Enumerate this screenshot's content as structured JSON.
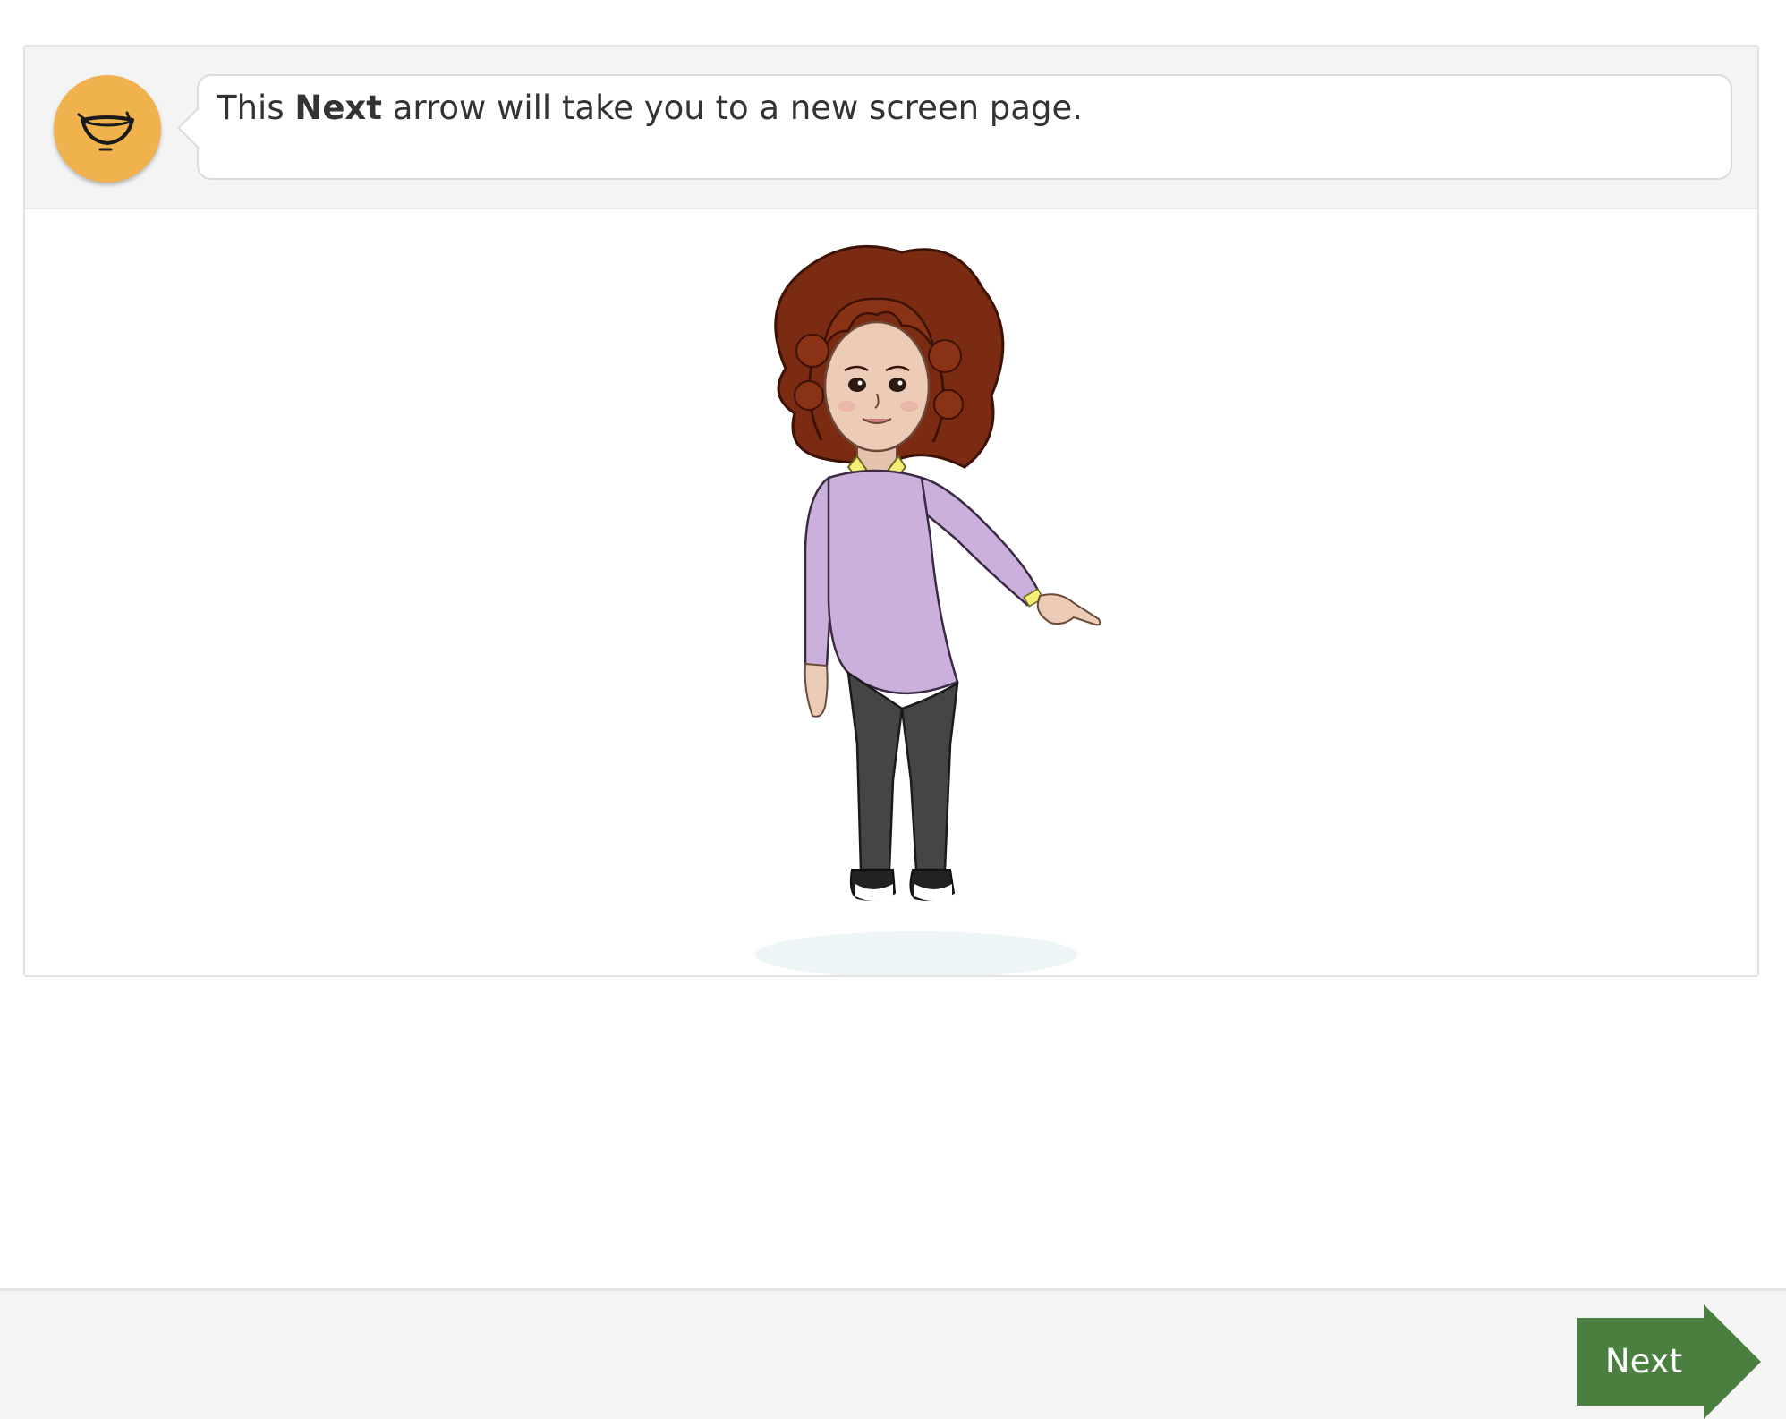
{
  "instruction": {
    "text_before": "This ",
    "text_bold": "Next",
    "text_after": " arrow will take you to a new screen page."
  },
  "speaker_icon": "smiling-mouth-icon",
  "illustration": {
    "character": "girl-pointing-right-illustration"
  },
  "footer": {
    "next_label": "Next"
  },
  "colors": {
    "speaker_button": "#f0b24d",
    "next_button": "#4a7f3f",
    "bar_background": "#f4f4f4"
  }
}
